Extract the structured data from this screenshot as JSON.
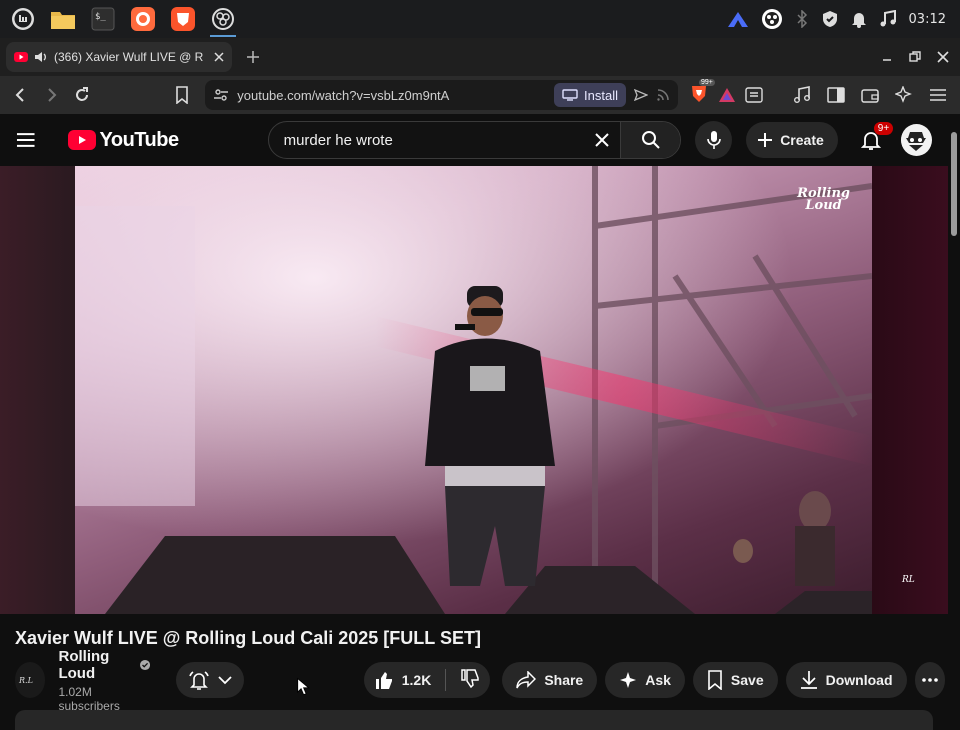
{
  "taskbar": {
    "apps": [
      "mint-menu",
      "files",
      "terminal",
      "firefox",
      "brave",
      "obs"
    ],
    "clock": "03:12"
  },
  "browser": {
    "tab_title": "(366) Xavier Wulf LIVE @ R",
    "url": "youtube.com/watch?v=vsbLz0m9ntA",
    "install_label": "Install",
    "brave_badge": "99+"
  },
  "youtube": {
    "logo_text": "YouTube",
    "search_value": "murder he wrote",
    "create_label": "Create",
    "notification_count": "9+"
  },
  "video": {
    "watermark_line1": "Rolling",
    "watermark_line2": "Loud",
    "title": "Xavier Wulf LIVE @ Rolling Loud Cali 2025 [FULL SET]"
  },
  "channel": {
    "name": "Rolling Loud",
    "subscribers": "1.02M subscribers"
  },
  "actions": {
    "likes": "1.2K",
    "share": "Share",
    "ask": "Ask",
    "save": "Save",
    "download": "Download"
  },
  "colors": {
    "yt_red": "#ff0033",
    "bg": "#0f0f0f",
    "pill": "#272727"
  }
}
